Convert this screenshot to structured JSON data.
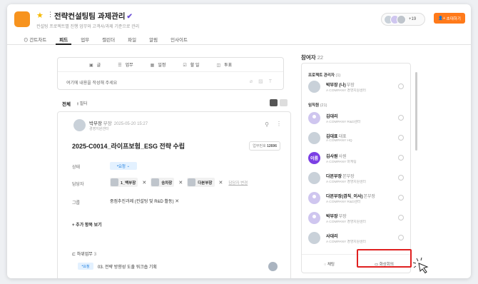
{
  "header": {
    "title": "전략컨설팅팀 과제관리",
    "subtitle": "컨설팅 프로젝트별 진행 업무와 고객사/과제 기준으로 관리",
    "member_count": "+19",
    "invite_label": "초대하기",
    "star_color": "#f5b800",
    "accent_color": "#ff7a1a"
  },
  "tabs": [
    "간트차트",
    "피드",
    "업무",
    "캘린더",
    "파일",
    "알림",
    "인사이트"
  ],
  "active_tab": "피드",
  "compose": {
    "types": [
      {
        "icon": "text-icon",
        "label": "글"
      },
      {
        "icon": "task-icon",
        "label": "업무"
      },
      {
        "icon": "calendar-icon",
        "label": "일정"
      },
      {
        "icon": "checkbox-icon",
        "label": "할 일"
      },
      {
        "icon": "vote-icon",
        "label": "투표"
      }
    ],
    "placeholder": "여기에 내용을 작성해 주세요"
  },
  "feed": {
    "filter_all": "전체",
    "filter_label": "필터"
  },
  "post": {
    "author": "박부장",
    "rank": "부장",
    "date": "2025-05-20 15:27",
    "org": "경영지원센터",
    "title": "2025-C0014_라이프보험_ESG 전략 수립",
    "number_label": "업무번호",
    "number": "12696",
    "status_label": "상태",
    "status": "요청",
    "assignee_label": "담당자",
    "assignees": [
      "1_백부장",
      "송차장",
      "다본부장"
    ],
    "change_assignee": "담당자 변경",
    "group_label": "그룹",
    "group": "중점추진과제 (컨설팅 및 R&D 활동)",
    "more_label": "추가 항목 보기",
    "subtasks_label": "하위업무",
    "subtasks_count": "3",
    "subtasks": [
      {
        "status": "요청",
        "title": "03. 전략 방향성 도출 워크숍 기획"
      }
    ]
  },
  "participants": {
    "title": "참여자",
    "count": "22",
    "managers_label": "프로젝트 관리자",
    "managers_count": "(1)",
    "employees_label": "임직원",
    "employees_count": "(21)",
    "managers": [
      {
        "name": "박부장 (나)",
        "rank": "부장",
        "org": "A COMPANY 경영지원센터",
        "avatar": "photo"
      }
    ],
    "employees": [
      {
        "name": "김대리",
        "rank": "",
        "org": "A COMPANY R&D센터",
        "avatar": "purple"
      },
      {
        "name": "김대표",
        "rank": "대표",
        "org": "A COMPANY HQ",
        "avatar": "photo"
      },
      {
        "name": "김사원",
        "rank": "사원",
        "org": "A COMPANY 마케팅",
        "avatar": "badge",
        "badge": "이름"
      },
      {
        "name": "다본부장",
        "rank": "본부장",
        "org": "A COMPANY 경영지원센터",
        "avatar": "photo"
      },
      {
        "name": "다본부장(겸직_이사)",
        "rank": "본부장",
        "org": "A COMPANY R&D센터",
        "avatar": "purple"
      },
      {
        "name": "박부장",
        "rank": "부장",
        "org": "A COMPANY 경영지원센터",
        "avatar": "purple"
      },
      {
        "name": "사대리",
        "rank": "",
        "org": "A COMPANY 경영지원센터",
        "avatar": "photo"
      }
    ],
    "chat_label": "채팅",
    "video_label": "화상회의"
  }
}
